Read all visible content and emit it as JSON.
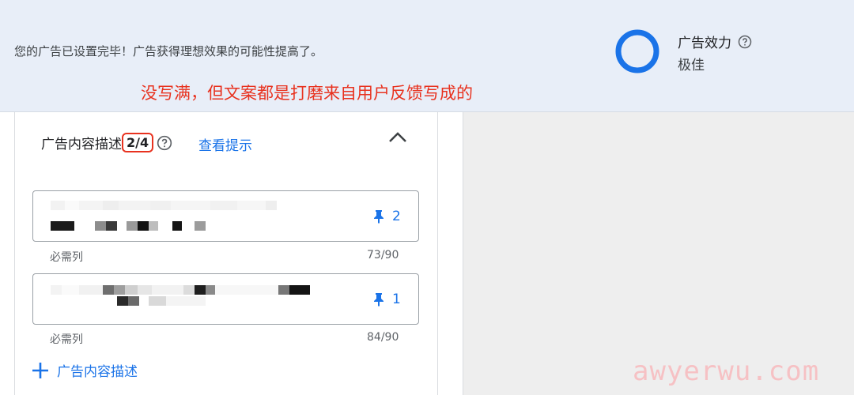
{
  "banner": {
    "message": "您的广告已设置完毕！广告获得理想效果的可能性提高了。",
    "annotation": "没写满，但文案都是打磨来自用户反馈写成的",
    "strength_title": "广告效力",
    "strength_value": "极佳",
    "strength_color": "#1a73e8"
  },
  "section": {
    "title": "广告内容描述",
    "count": "2/4",
    "view_tips": "查看提示"
  },
  "fields": [
    {
      "pin_number": "2",
      "required_label": "必需列",
      "char_count": "73/90"
    },
    {
      "pin_number": "1",
      "required_label": "必需列",
      "char_count": "84/90"
    }
  ],
  "add_button_label": "广告内容描述",
  "watermark": "awyerwu.com",
  "colors": {
    "accent": "#1a73e8",
    "highlight": "#e8321f"
  }
}
